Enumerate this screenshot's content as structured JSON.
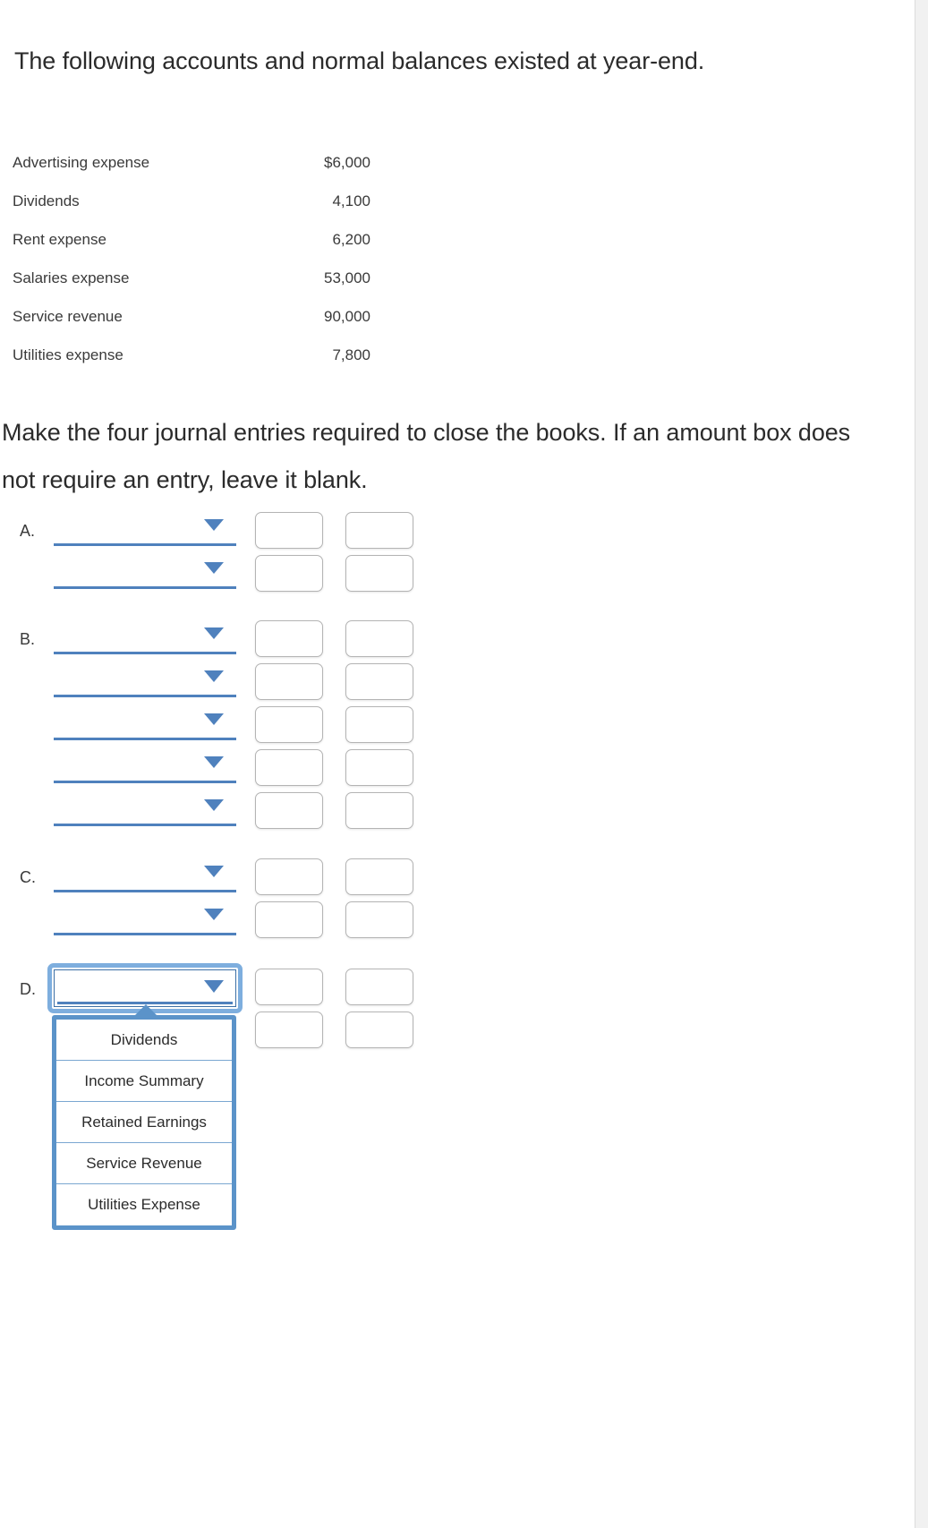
{
  "prompts": {
    "intro": "The following accounts and normal balances existed at year-end.",
    "instruction": "Make the four journal entries required to close the books. If an amount box does not require an entry, leave it blank."
  },
  "accounts_table": {
    "rows": [
      {
        "name": "Advertising expense",
        "amount": "$6,000"
      },
      {
        "name": "Dividends",
        "amount": "4,100"
      },
      {
        "name": "Rent expense",
        "amount": "6,200"
      },
      {
        "name": "Salaries expense",
        "amount": "53,000"
      },
      {
        "name": "Service revenue",
        "amount": "90,000"
      },
      {
        "name": "Utilities expense",
        "amount": "7,800"
      }
    ]
  },
  "journal_entries": [
    {
      "letter": "A.",
      "line_count": 2,
      "lines": [
        {
          "account": "",
          "debit": "",
          "credit": ""
        },
        {
          "account": "",
          "debit": "",
          "credit": ""
        }
      ]
    },
    {
      "letter": "B.",
      "line_count": 5,
      "lines": [
        {
          "account": "",
          "debit": "",
          "credit": ""
        },
        {
          "account": "",
          "debit": "",
          "credit": ""
        },
        {
          "account": "",
          "debit": "",
          "credit": ""
        },
        {
          "account": "",
          "debit": "",
          "credit": ""
        },
        {
          "account": "",
          "debit": "",
          "credit": ""
        }
      ]
    },
    {
      "letter": "C.",
      "line_count": 2,
      "lines": [
        {
          "account": "",
          "debit": "",
          "credit": ""
        },
        {
          "account": "",
          "debit": "",
          "credit": ""
        }
      ]
    },
    {
      "letter": "D.",
      "line_count": 2,
      "open": true,
      "lines": [
        {
          "account": "",
          "debit": "",
          "credit": ""
        },
        {
          "account": "",
          "debit": "",
          "credit": ""
        }
      ]
    }
  ],
  "dropdown": {
    "open": true,
    "selected": "",
    "options": [
      "Dividends",
      "Income Summary",
      "Retained Earnings",
      "Service Revenue",
      "Utilities Expense"
    ]
  },
  "icons": {
    "select_caret": "chevron-down-icon",
    "dropdown_pointer": "caret-up-icon"
  },
  "colors": {
    "accent_blue": "#4f81bd",
    "focus_blue": "#7eaede",
    "dropdown_border": "#5b93c9",
    "text": "#2b2b2b",
    "box_border": "#b4b4b4",
    "scrollbar_track": "#f1f1f1"
  }
}
